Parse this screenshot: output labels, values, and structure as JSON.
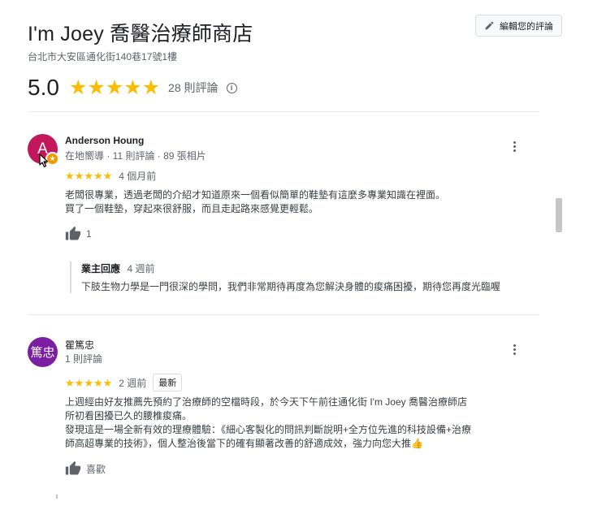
{
  "store": {
    "title": "I'm Joey 喬醫治療師商店",
    "address": "台北市大安區通化街140巷17號1樓",
    "rating": "5.0",
    "stars": 5,
    "review_count": "28 則評論"
  },
  "edit_button": {
    "label": "編輯您的評論"
  },
  "reviews": [
    {
      "name": "Anderson Houng",
      "avatar_letter": "A",
      "avatar_color": "#c2185b",
      "meta": "在地嚮導 · 11 則評論 · 89 張相片",
      "stars": 5,
      "time": "4 個月前",
      "text": [
        "老闆很專業，透過老闆的介紹才知道原來一個看似簡單的鞋墊有這麼多專業知識在裡面。",
        "買了一個鞋墊，穿起來很舒服，而且走起路來感覺更輕鬆。"
      ],
      "likes": "1",
      "owner_reply": {
        "label": "業主回應",
        "time": "4 週前",
        "text": "下肢生物力學是一門很深的學問，我們非常期待再度為您解決身體的痠痛困擾，期待您再度光臨喔"
      }
    },
    {
      "name": "瞿篤忠",
      "avatar_letter": "篤忠",
      "avatar_color": "#7b1fa2",
      "meta": "1 則評論",
      "stars": 5,
      "time": "2 週前",
      "badge": "最新",
      "text": [
        "上週經由好友推薦先預約了治療師的空檔時段，於今天下午前往通化街 I'm Joey 喬醫治療師店所初看困擾已久的腰椎痠痛。",
        "發現這是一場全新有效的理療體驗：《細心客製化的問訊判斷說明+全方位先進的科技設備+治療師高超專業的技術》，個人整治後當下的確有顯著改善的舒適成效，強力向您大推👍"
      ],
      "like_label": "喜歡"
    }
  ]
}
